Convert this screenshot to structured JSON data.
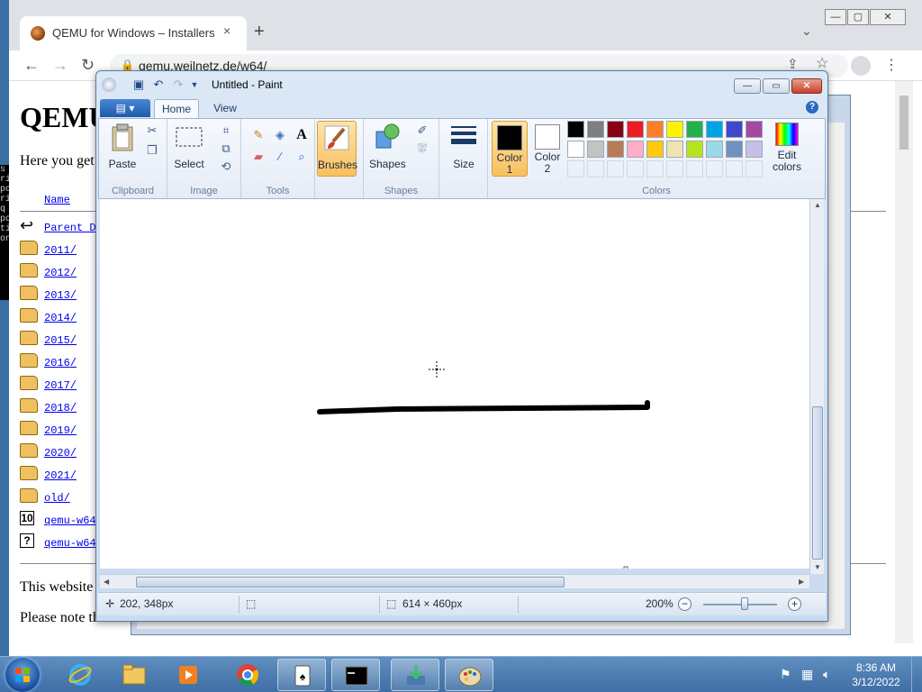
{
  "chrome": {
    "tab_title": "QEMU for Windows – Installers (",
    "tab_close": "×",
    "newtab": "+",
    "tab_search": "⌄",
    "url": "qemu.weilnetz.de/w64/",
    "win_min": "—",
    "win_max": "▢",
    "win_close": "✕"
  },
  "webpage": {
    "heading": "QEMU",
    "intro": "Here you get",
    "column_name": "Name",
    "entries": [
      {
        "icon": "back",
        "label": "Parent D"
      },
      {
        "icon": "folder",
        "label": "2011/"
      },
      {
        "icon": "folder",
        "label": "2012/"
      },
      {
        "icon": "folder",
        "label": "2013/"
      },
      {
        "icon": "folder",
        "label": "2014/"
      },
      {
        "icon": "folder",
        "label": "2015/"
      },
      {
        "icon": "folder",
        "label": "2016/"
      },
      {
        "icon": "folder",
        "label": "2017/"
      },
      {
        "icon": "folder",
        "label": "2018/"
      },
      {
        "icon": "folder",
        "label": "2019/"
      },
      {
        "icon": "folder",
        "label": "2020/"
      },
      {
        "icon": "folder",
        "label": "2021/"
      },
      {
        "icon": "folder",
        "label": "old/"
      },
      {
        "icon": "binary",
        "label": "qemu-w64"
      },
      {
        "icon": "unknown",
        "label": "qemu-w64"
      }
    ],
    "footer1": "This website",
    "footer2": "Please note that"
  },
  "console": {
    "text": "s ri po ri q po ti on"
  },
  "paint": {
    "title": "Untitled - Paint",
    "tabs": {
      "home": "Home",
      "view": "View"
    },
    "help": "?",
    "ribbon": {
      "clipboard": {
        "label": "Clipboard",
        "paste": "Paste"
      },
      "image": {
        "label": "Image",
        "select": "Select"
      },
      "tools": {
        "label": "Tools"
      },
      "brushes": "Brushes",
      "shapes": {
        "label": "Shapes",
        "button": "Shapes"
      },
      "size": "Size",
      "colors": {
        "label": "Colors",
        "color1": "Color\n1",
        "color1_value": "#000000",
        "color2": "Color\n2",
        "color2_value": "#ffffff",
        "edit": "Edit colors",
        "palette_row1": [
          "#000000",
          "#7f7f7f",
          "#880015",
          "#ed1c24",
          "#ff7f27",
          "#fff200",
          "#22b14c",
          "#00a2e8",
          "#3f48cc",
          "#a349a4"
        ],
        "palette_row2": [
          "#ffffff",
          "#c3c3c3",
          "#b97a57",
          "#ffaec9",
          "#ffc90e",
          "#efe4b0",
          "#b5e61d",
          "#99d9ea",
          "#7092be",
          "#c8bfe7"
        ],
        "palette_row3": [
          "#ffffff",
          "#ffffff",
          "#ffffff",
          "#ffffff",
          "#ffffff",
          "#ffffff",
          "#ffffff",
          "#ffffff",
          "#ffffff",
          "#ffffff"
        ]
      }
    },
    "status": {
      "cursor_pos": "202, 348px",
      "canvas_size": "614 × 460px",
      "zoom": "200%"
    }
  },
  "taskbar": {
    "clock_time": "8:36 AM",
    "clock_date": "3/12/2022",
    "apps": [
      "internet-explorer",
      "file-explorer",
      "media-player",
      "chrome",
      "solitaire",
      "command-prompt",
      "network-installer",
      "paint"
    ]
  }
}
